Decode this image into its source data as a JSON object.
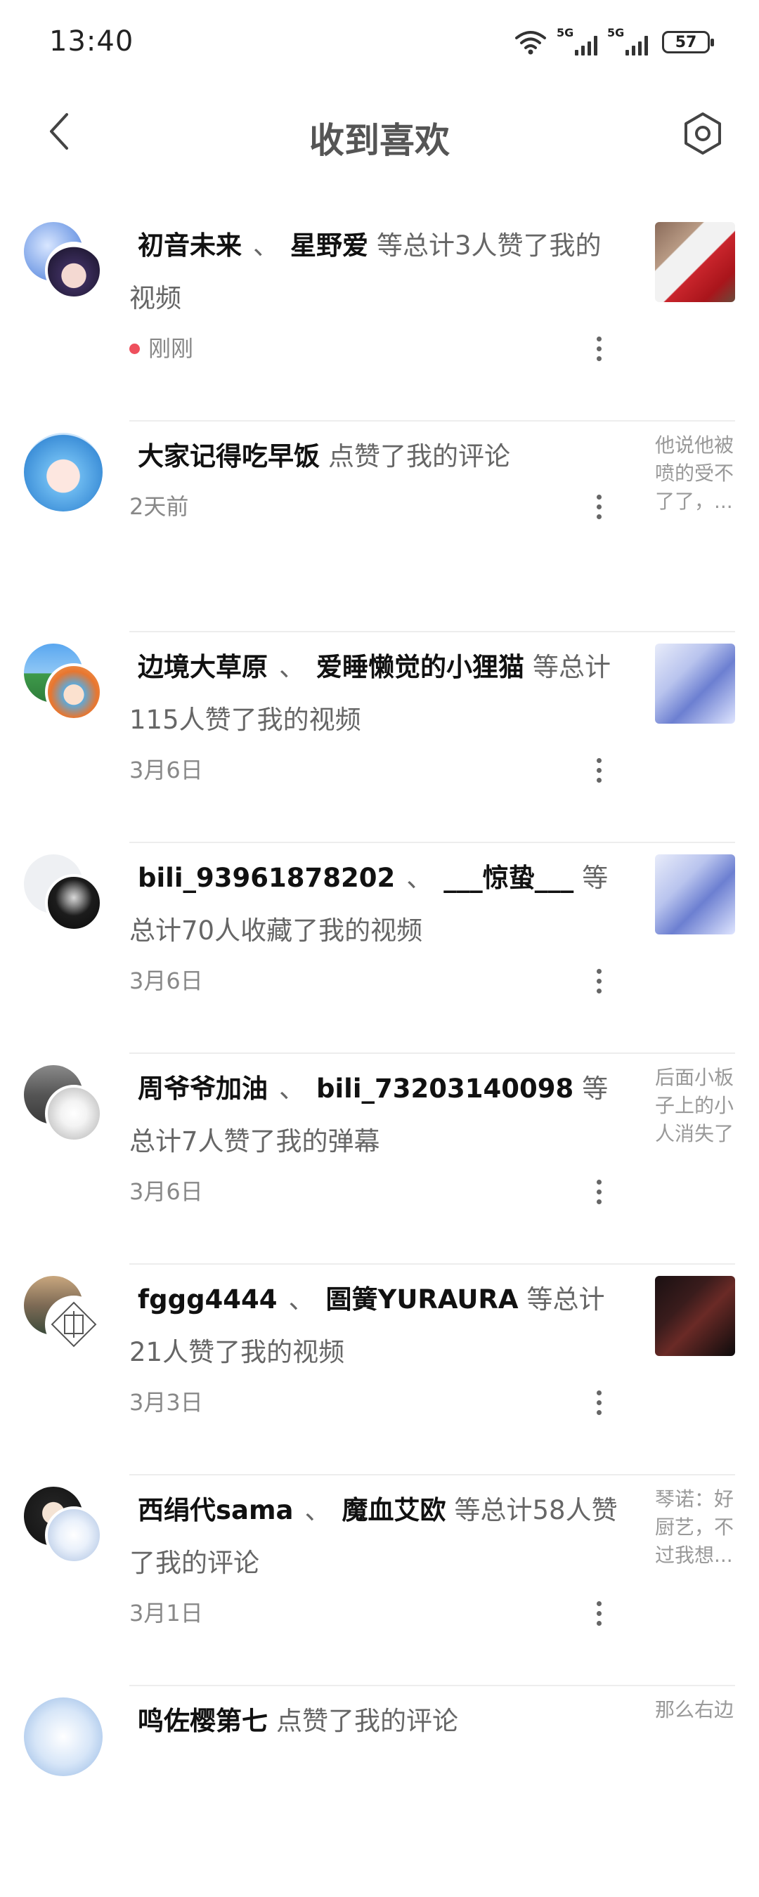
{
  "status_bar": {
    "time": "13:40",
    "net1": "5G",
    "net2": "5G",
    "battery": "57"
  },
  "header": {
    "title": "收到喜欢"
  },
  "items": [
    {
      "names": [
        "初音未来",
        "星野爱"
      ],
      "separator": "、",
      "action": "等总计3人赞了我的视频",
      "time": "刚刚",
      "is_new": true,
      "preview": "thumb"
    },
    {
      "names": [
        "大家记得吃早饭"
      ],
      "separator": "",
      "action": "点赞了我的评论",
      "time": "2天前",
      "is_new": false,
      "preview": "text",
      "excerpt": "他说他被喷的受不了了，..."
    },
    {
      "names": [
        "边境大草原",
        "爱睡懒觉的小狸猫"
      ],
      "separator": "、",
      "action": "等总计115人赞了我的视频",
      "time": "3月6日",
      "is_new": false,
      "preview": "thumb"
    },
    {
      "names": [
        "bili_93961878202",
        "___惊蛰___"
      ],
      "separator": "、",
      "action": "等总计70人收藏了我的视频",
      "time": "3月6日",
      "is_new": false,
      "preview": "thumb"
    },
    {
      "names": [
        "周爷爷加油",
        "bili_73203140098"
      ],
      "separator": "、",
      "action": "等总计7人赞了我的弹幕",
      "time": "3月6日",
      "is_new": false,
      "preview": "text",
      "excerpt": "后面小板子上的小人消失了"
    },
    {
      "names": [
        "fggg4444",
        "圄簧YURAURA"
      ],
      "separator": "、",
      "action": "等总计21人赞了我的视频",
      "time": "3月3日",
      "is_new": false,
      "preview": "thumb"
    },
    {
      "names": [
        "西绢代sama",
        "魔血艾欧"
      ],
      "separator": "、",
      "action": "等总计58人赞了我的评论",
      "time": "3月1日",
      "is_new": false,
      "preview": "text",
      "excerpt": "琴诺：好厨艺，不过我想..."
    },
    {
      "names": [
        "鸣佐樱第七"
      ],
      "separator": "",
      "action": "点赞了我的评论",
      "time": "",
      "is_new": false,
      "preview": "text",
      "excerpt": "那么右边"
    }
  ]
}
